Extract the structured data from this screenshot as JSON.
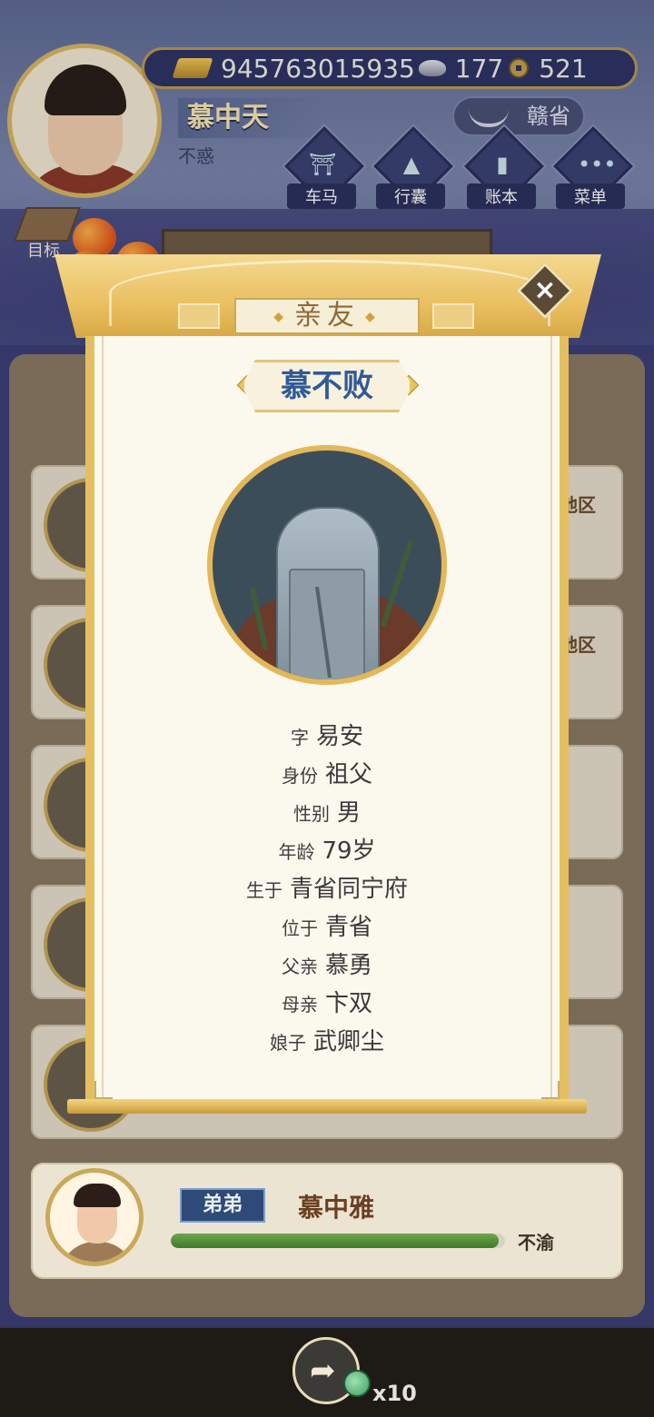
{
  "hud": {
    "player_name": "慕中天",
    "player_title": "不惑",
    "currencies": {
      "gold": "945763015935",
      "silver": "177",
      "coin": "521"
    },
    "province": "赣省",
    "menu": [
      {
        "label": "车马",
        "icon": "carriage-icon"
      },
      {
        "label": "行囊",
        "icon": "bag-icon"
      },
      {
        "label": "账本",
        "icon": "ledger-icon"
      },
      {
        "label": "菜单",
        "icon": "more-icon"
      }
    ],
    "goal_label": "目标"
  },
  "background_cards": {
    "region_labels": [
      "地区",
      "地区"
    ]
  },
  "modal": {
    "title": "亲友",
    "name": "慕不败",
    "portrait_icon": "tombstone-icon",
    "info": [
      {
        "key": "字",
        "value": "易安"
      },
      {
        "key": "身份",
        "value": "祖父"
      },
      {
        "key": "性别",
        "value": "男"
      },
      {
        "key": "年龄",
        "value": "79岁"
      },
      {
        "key": "生于",
        "value": "青省同宁府"
      },
      {
        "key": "位于",
        "value": "青省"
      },
      {
        "key": "父亲",
        "value": "慕勇"
      },
      {
        "key": "母亲",
        "value": "卞双"
      },
      {
        "key": "娘子",
        "value": "武卿尘"
      }
    ],
    "close_icon": "close-icon"
  },
  "relative_card": {
    "relation": "弟弟",
    "name": "慕中雅",
    "status": "不渝",
    "health_fraction": 0.98
  },
  "bottom_bar": {
    "token_count": "x10"
  },
  "colors": {
    "accent_gold": "#e4bf62",
    "name_blue": "#2f5a97",
    "health_green": "#3f7a2c"
  }
}
